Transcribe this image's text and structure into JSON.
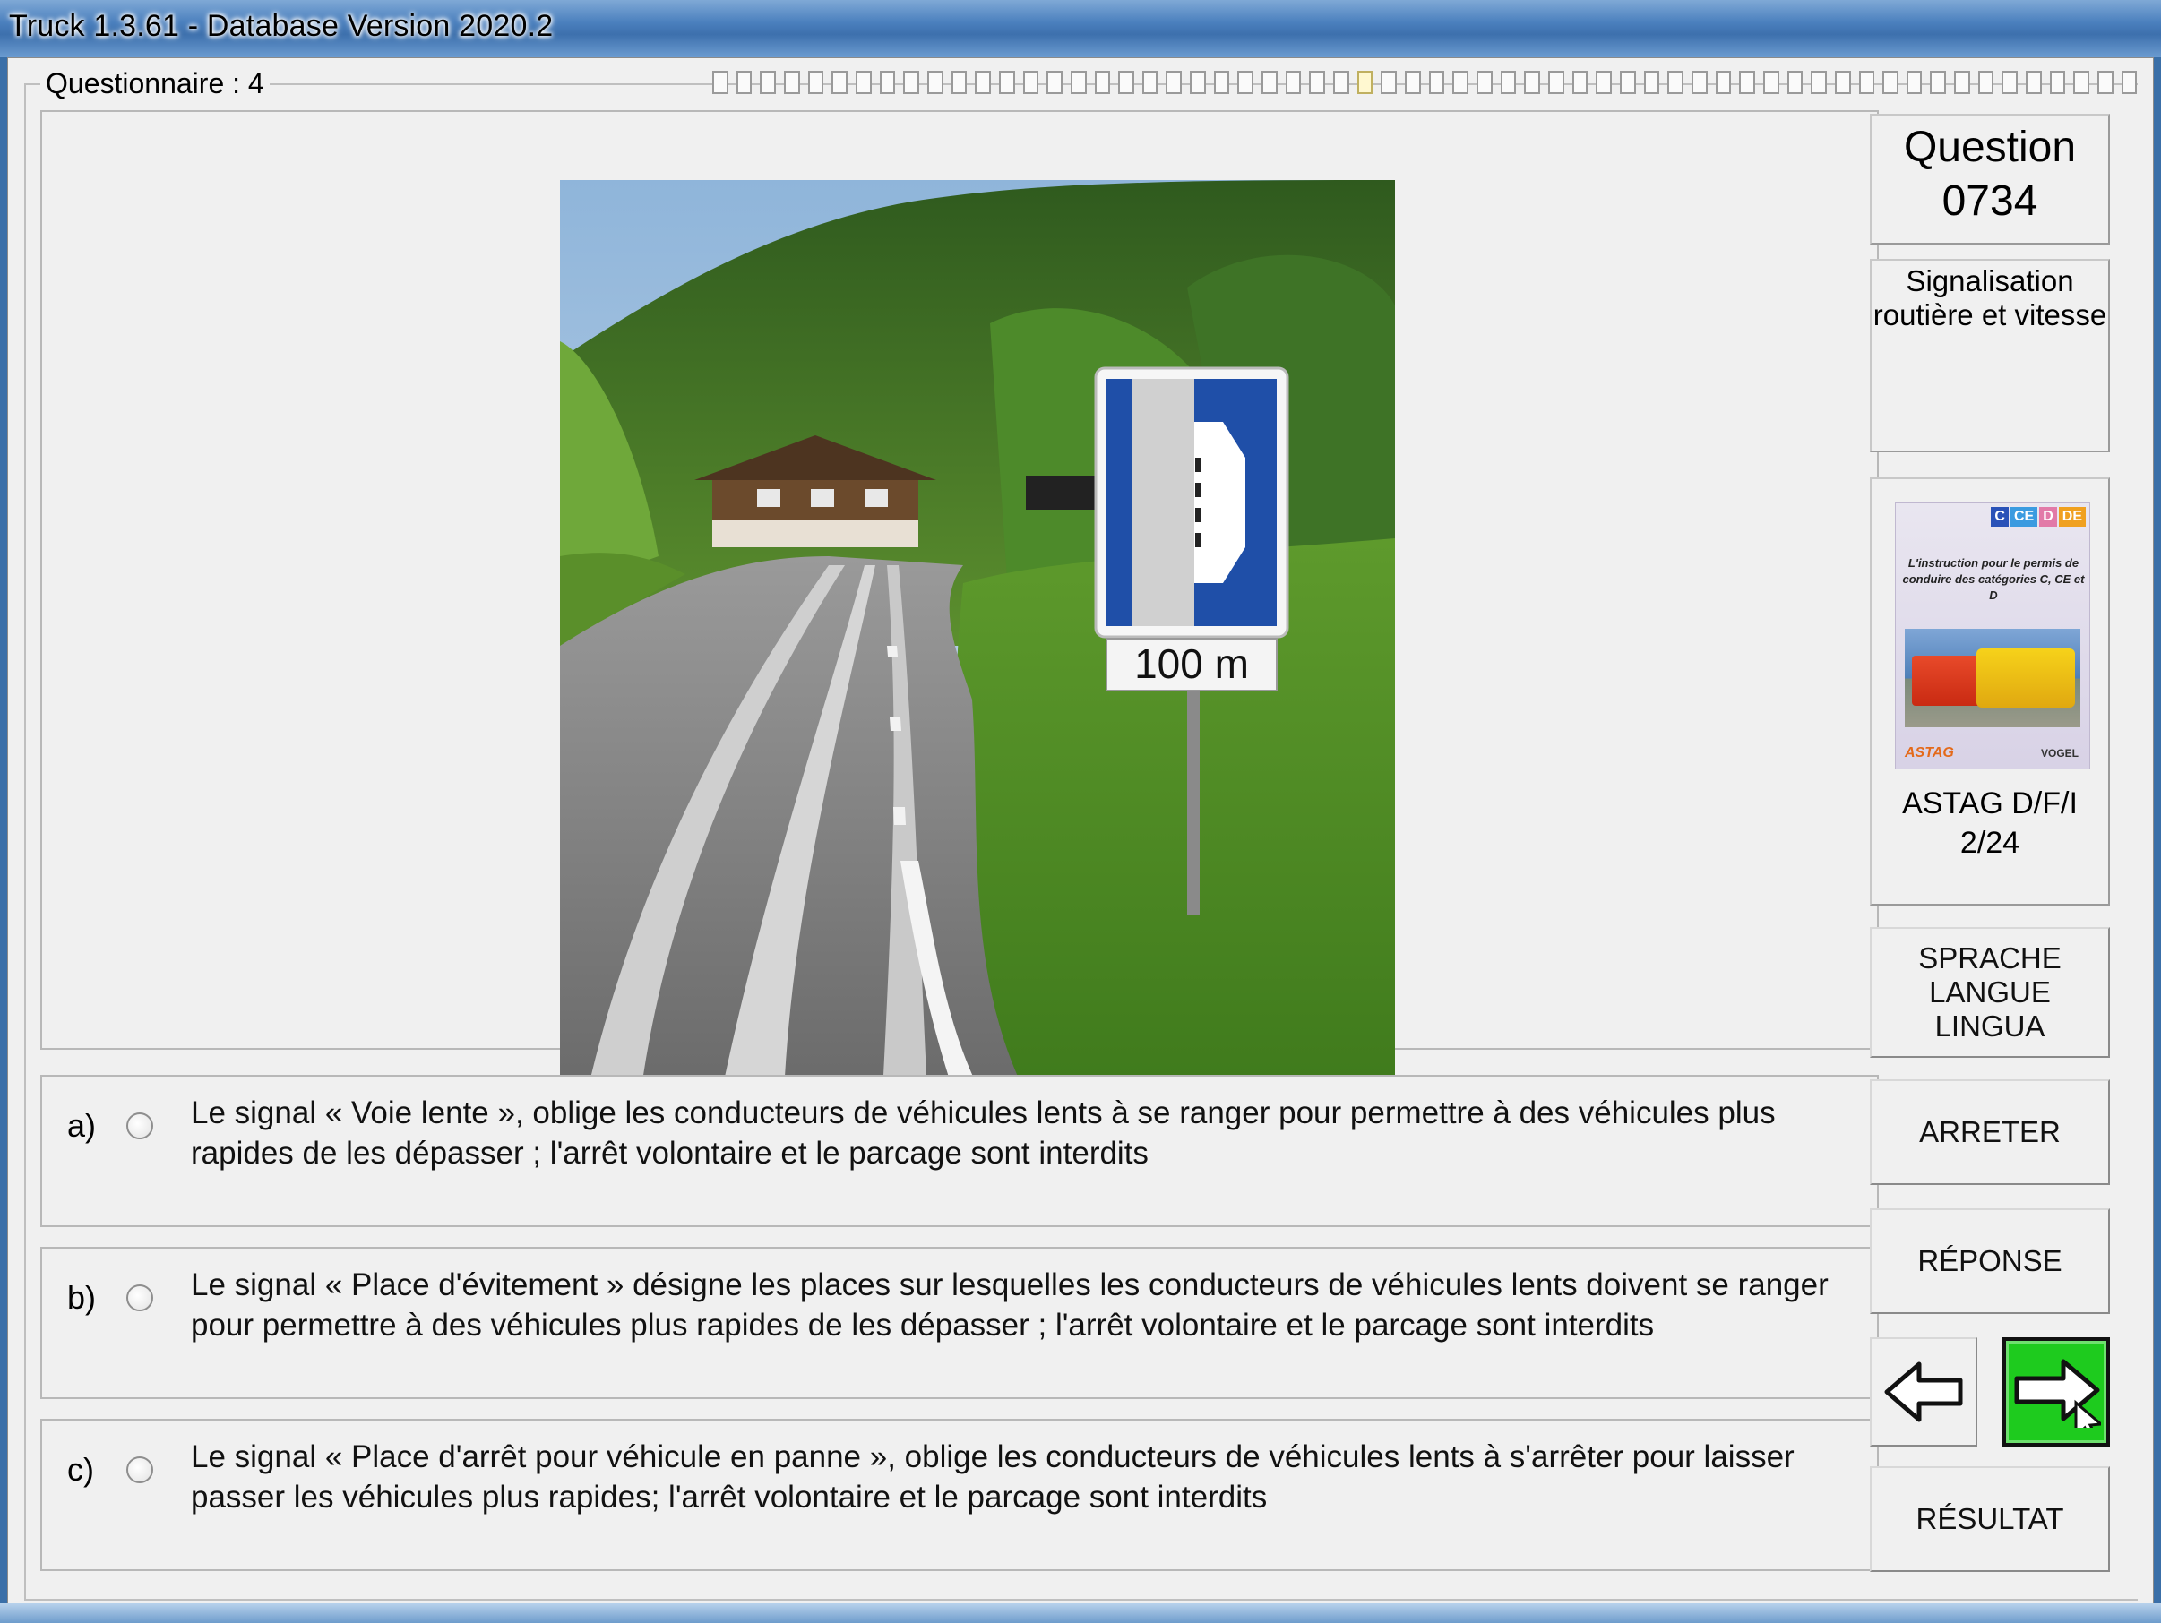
{
  "window": {
    "title": "Truck 1.3.61 - Database Version 2020.2"
  },
  "questionnaire": {
    "label": "Questionnaire : 4",
    "progress_total": 60,
    "progress_current": 27
  },
  "question": {
    "heading": "Question",
    "number": "0734"
  },
  "category": {
    "line1": "Signalisation",
    "line2": "routière et vitesse"
  },
  "reference": {
    "caption_line1": "ASTAG D/F/I",
    "caption_line2": "2/24",
    "cover_tags": [
      "C",
      "CE",
      "D",
      "DE"
    ],
    "cover_text": "L'instruction pour le permis de conduire des catégories C, CE et D",
    "cover_logo_left": "ASTAG",
    "cover_logo_right": "VOGEL"
  },
  "photo": {
    "sign_text": "100 m"
  },
  "answers": [
    {
      "letter": "a)",
      "text": "Le signal « Voie lente », oblige les conducteurs de véhicules lents à se ranger pour permettre à des véhicules plus rapides de les dépasser ; l'arrêt volontaire et le parcage sont interdits"
    },
    {
      "letter": "b)",
      "text": "Le signal « Place d'évitement » désigne les places sur lesquelles les conducteurs de véhicules lents doivent se ranger pour permettre à des véhicules plus rapides de les dépasser ; l'arrêt volontaire et le parcage sont interdits"
    },
    {
      "letter": "c)",
      "text": "Le signal « Place d'arrêt pour véhicule en panne », oblige les conducteurs de véhicules lents à s'arrêter pour laisser passer les véhicules plus rapides; l'arrêt volontaire et le parcage sont interdits"
    }
  ],
  "buttons": {
    "language_line1": "SPRACHE",
    "language_line2": "LANGUE",
    "language_line3": "LINGUA",
    "stop": "ARRETER",
    "answer": "RÉPONSE",
    "result": "RÉSULTAT"
  },
  "colors": {
    "next_button": "#1ecb1e",
    "sign_blue": "#1f4fa8"
  }
}
